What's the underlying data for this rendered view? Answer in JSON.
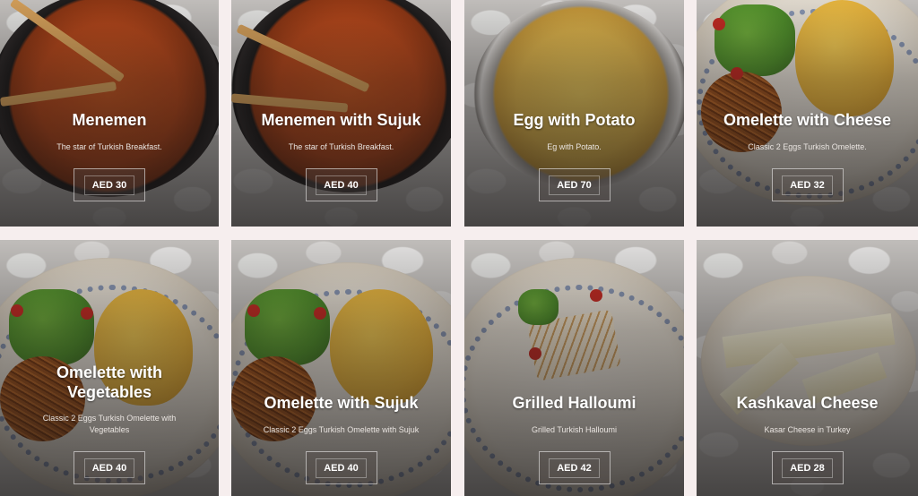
{
  "menu": {
    "items": [
      {
        "name": "Menemen",
        "description": "The star of Turkish Breakfast.",
        "currency": "AED",
        "price": "30",
        "photo": "menemen-pan"
      },
      {
        "name": "Menemen with Sujuk",
        "description": "The star of Turkish Breakfast.",
        "currency": "AED",
        "price": "40",
        "photo": "menemen-sujuk-pan"
      },
      {
        "name": "Egg with Potato",
        "description": "Eg with Potato.",
        "currency": "AED",
        "price": "70",
        "photo": "egg-potato-pan"
      },
      {
        "name": "Omelette with Cheese",
        "description": "Classic 2 Eggs Turkish Omelette.",
        "currency": "AED",
        "price": "32",
        "photo": "omelette-plate"
      },
      {
        "name": "Omelette with Vegetables",
        "description": "Classic 2 Eggs Turkish Omelette with Vegetables",
        "currency": "AED",
        "price": "40",
        "photo": "omelette-plate"
      },
      {
        "name": "Omelette with Sujuk",
        "description": "Classic 2 Eggs Turkish Omelette with Sujuk",
        "currency": "AED",
        "price": "40",
        "photo": "omelette-plate"
      },
      {
        "name": "Grilled Halloumi",
        "description": "Grilled Turkish Halloumi",
        "currency": "AED",
        "price": "42",
        "photo": "halloumi-plate"
      },
      {
        "name": "Kashkaval Cheese",
        "description": "Kasar Cheese in Turkey",
        "currency": "AED",
        "price": "28",
        "photo": "cheese-plate"
      }
    ]
  },
  "colors": {
    "page_background": "#f6eeee",
    "card_overlay": "#141212",
    "text": "#ffffff"
  }
}
